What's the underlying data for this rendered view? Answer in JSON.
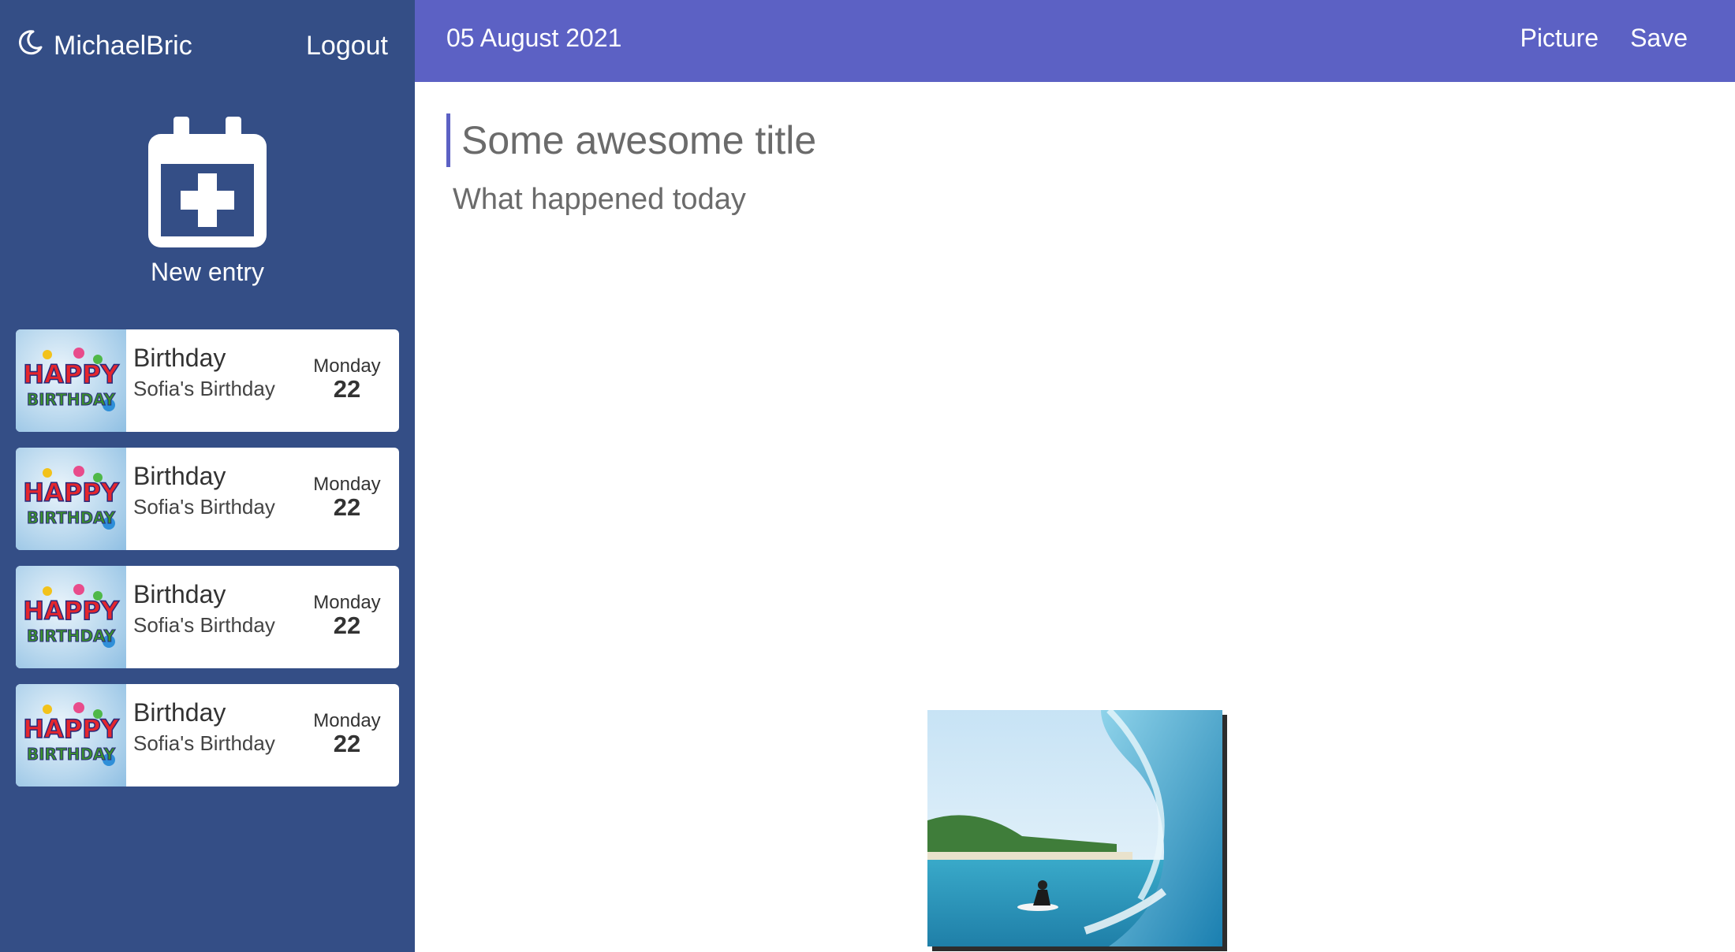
{
  "sidebar": {
    "username": "MichaelBric",
    "user_icon": "moon-icon",
    "logout_label": "Logout",
    "new_entry_label": "New entry",
    "new_entry_icon": "calendar-plus-icon",
    "entries": [
      {
        "title": "Birthday",
        "subtitle": "Sofia's Birthday",
        "weekday": "Monday",
        "day": "22",
        "thumb_text": [
          "HAPPY",
          "BIRTHDAY"
        ]
      },
      {
        "title": "Birthday",
        "subtitle": "Sofia's Birthday",
        "weekday": "Monday",
        "day": "22",
        "thumb_text": [
          "HAPPY",
          "BIRTHDAY"
        ]
      },
      {
        "title": "Birthday",
        "subtitle": "Sofia's Birthday",
        "weekday": "Monday",
        "day": "22",
        "thumb_text": [
          "HAPPY",
          "BIRTHDAY"
        ]
      },
      {
        "title": "Birthday",
        "subtitle": "Sofia's Birthday",
        "weekday": "Monday",
        "day": "22",
        "thumb_text": [
          "HAPPY",
          "BIRTHDAY"
        ]
      }
    ]
  },
  "topbar": {
    "date": "05 August 2021",
    "picture_label": "Picture",
    "save_label": "Save"
  },
  "editor": {
    "title_placeholder": "Some awesome title",
    "body_placeholder": "What happened today",
    "photo": "surfer-wave-image"
  },
  "colors": {
    "sidebar_bg": "#344e86",
    "topbar_bg": "#5c61c4",
    "accent": "#5c61c4"
  }
}
